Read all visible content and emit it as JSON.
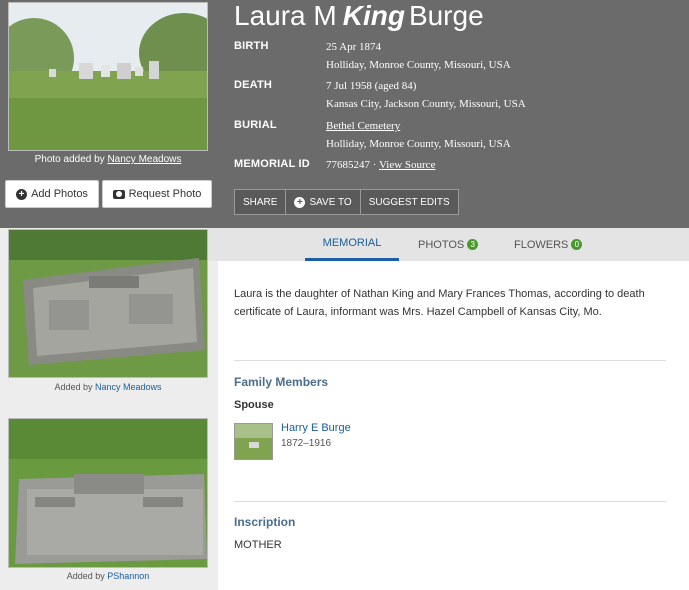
{
  "memorial": {
    "first_name": "Laura M",
    "maiden_name": "King",
    "last_name": "Burge"
  },
  "main_photo": {
    "caption_prefix": "Photo added by",
    "added_by": "Nancy Meadows"
  },
  "buttons": {
    "add_photos": "Add Photos",
    "request_photo": "Request Photo"
  },
  "vitals": {
    "birth_label": "BIRTH",
    "birth_date": "25 Apr 1874",
    "birth_place": "Holliday, Monroe County, Missouri, USA",
    "death_label": "DEATH",
    "death_date": "7 Jul 1958 (aged 84)",
    "death_place": "Kansas City, Jackson County, Missouri, USA",
    "burial_label": "BURIAL",
    "burial_cemetery": "Bethel Cemetery",
    "burial_place": "Holliday, Monroe County, Missouri, USA",
    "id_label": "MEMORIAL ID",
    "memorial_id": "77685247",
    "id_separator": "·",
    "view_source": "View Source"
  },
  "actions": {
    "share": "SHARE",
    "save_to": "SAVE TO",
    "suggest_edits": "SUGGEST EDITS"
  },
  "tabs": [
    {
      "label": "MEMORIAL",
      "count": ""
    },
    {
      "label": "PHOTOS",
      "count": "3"
    },
    {
      "label": "FLOWERS",
      "count": "0"
    }
  ],
  "gallery": [
    {
      "caption_prefix": "Added by",
      "added_by": "Nancy Meadows"
    },
    {
      "caption_prefix": "Added by",
      "added_by": "PShannon"
    }
  ],
  "bio": "Laura is the daughter of Nathan King and Mary Frances Thomas, according to death certificate of Laura, informant was Mrs. Hazel Campbell of Kansas City, Mo.",
  "family": {
    "title": "Family Members",
    "relation": "Spouse",
    "members": [
      {
        "name": "Harry E Burge",
        "dates": "1872–1916"
      }
    ]
  },
  "inscription": {
    "title": "Inscription",
    "text": "MOTHER"
  },
  "colors": {
    "header_bg": "#6b6b6b",
    "link": "#1a5fa0",
    "section_title": "#4a6d8c",
    "badge": "#4a9a2a"
  }
}
